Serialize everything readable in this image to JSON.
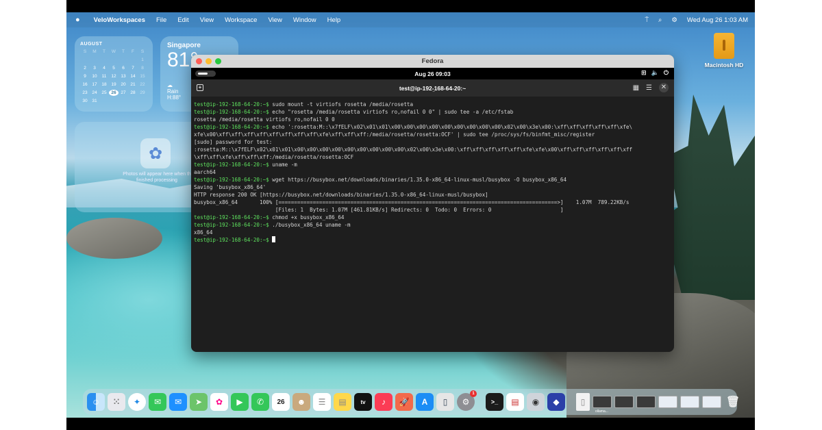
{
  "menubar": {
    "app_name": "VeloWorkspaces",
    "items": [
      "File",
      "Edit",
      "View",
      "Workspace",
      "View",
      "Window",
      "Help"
    ],
    "datetime": "Wed Aug 26  1:03 AM"
  },
  "calendar": {
    "month": "AUGUST",
    "weekdays": [
      "S",
      "M",
      "T",
      "W",
      "T",
      "F",
      "S"
    ],
    "rows": [
      [
        "",
        "",
        "",
        "",
        "",
        "",
        "1"
      ],
      [
        "2",
        "3",
        "4",
        "5",
        "6",
        "7",
        "8"
      ],
      [
        "9",
        "10",
        "11",
        "12",
        "13",
        "14",
        "15"
      ],
      [
        "16",
        "17",
        "18",
        "19",
        "20",
        "21",
        "22"
      ],
      [
        "23",
        "24",
        "25",
        "26",
        "27",
        "28",
        "29"
      ],
      [
        "30",
        "31",
        "",
        "",
        "",
        "",
        ""
      ]
    ],
    "today": "26"
  },
  "weather": {
    "city": "Singapore",
    "temp": "81°",
    "condition": "Rain",
    "hi": "H:88°"
  },
  "photos_widget": {
    "text_line1": "Photos will appear here when th",
    "text_line2": "finished processing"
  },
  "desktop_icon": {
    "label": "Macintosh HD"
  },
  "window": {
    "title": "Fedora",
    "gnome_time": "Aug 26  09:03",
    "terminal_title": "test@ip-192-168-64-20:~",
    "terminal_subtitle": "–",
    "prompt": "test@ip-192-168-64-20:~$",
    "lines": [
      {
        "p": true,
        "t": " sudo mount -t virtiofs rosetta /media/rosetta"
      },
      {
        "p": true,
        "t": " echo \"rosetta /media/rosetta virtiofs ro,nofail 0 0\" | sudo tee -a /etc/fstab"
      },
      {
        "p": false,
        "t": "rosetta /media/rosetta virtiofs ro,nofail 0 0"
      },
      {
        "p": true,
        "t": " echo ':rosetta:M::\\x7fELF\\x02\\x01\\x01\\x00\\x00\\x00\\x00\\x00\\x00\\x00\\x00\\x00\\x02\\x00\\x3e\\x00:\\xff\\xff\\xff\\xff\\xff\\xfe\\"
      },
      {
        "p": false,
        "t": "xfe\\x00\\xff\\xff\\xff\\xff\\xff\\xff\\xff\\xff\\xfe\\xff\\xff\\xff:/media/rosetta/rosetta:OCF' | sudo tee /proc/sys/fs/binfmt_misc/register"
      },
      {
        "p": false,
        "t": "[sudo] password for test:"
      },
      {
        "p": false,
        "t": ":rosetta:M::\\x7fELF\\x02\\x01\\x01\\x00\\x00\\x00\\x00\\x00\\x00\\x00\\x00\\x00\\x02\\x00\\x3e\\x00:\\xff\\xff\\xff\\xff\\xff\\xfe\\xfe\\x00\\xff\\xff\\xff\\xff\\xff\\xff"
      },
      {
        "p": false,
        "t": "\\xff\\xff\\xfe\\xff\\xff\\xff:/media/rosetta/rosetta:OCF"
      },
      {
        "p": true,
        "t": " uname -m"
      },
      {
        "p": false,
        "t": "aarch64"
      },
      {
        "p": true,
        "t": " wget https://busybox.net/downloads/binaries/1.35.0-x86_64-linux-musl/busybox -O busybox_x86_64"
      },
      {
        "p": false,
        "t": "Saving 'busybox_x86_64'"
      },
      {
        "p": false,
        "t": "HTTP response 200 OK [https://busybox.net/downloads/binaries/1.35.0-x86_64-linux-musl/busybox]"
      },
      {
        "p": false,
        "t": "busybox_x86_64       100% [=========================================================================================>]    1.07M  789.22KB/s"
      },
      {
        "p": false,
        "t": "                          [Files: 1  Bytes: 1.07M [461.81KB/s] Redirects: 0  Todo: 0  Errors: 0                      ]"
      },
      {
        "p": true,
        "t": " chmod +x busybox_x86_64"
      },
      {
        "p": true,
        "t": " ./busybox_x86_64 uname -m"
      },
      {
        "p": false,
        "t": "x86_64"
      }
    ]
  },
  "dock": {
    "calendar_day": "26",
    "settings_badge": "1",
    "thumb_label": "ollama..."
  },
  "colors": {
    "prompt_green": "#5ee05e",
    "terminal_bg": "#1e1e1e",
    "close_red": "#fe5f57",
    "min_yellow": "#febc2e",
    "max_green": "#28c840"
  }
}
